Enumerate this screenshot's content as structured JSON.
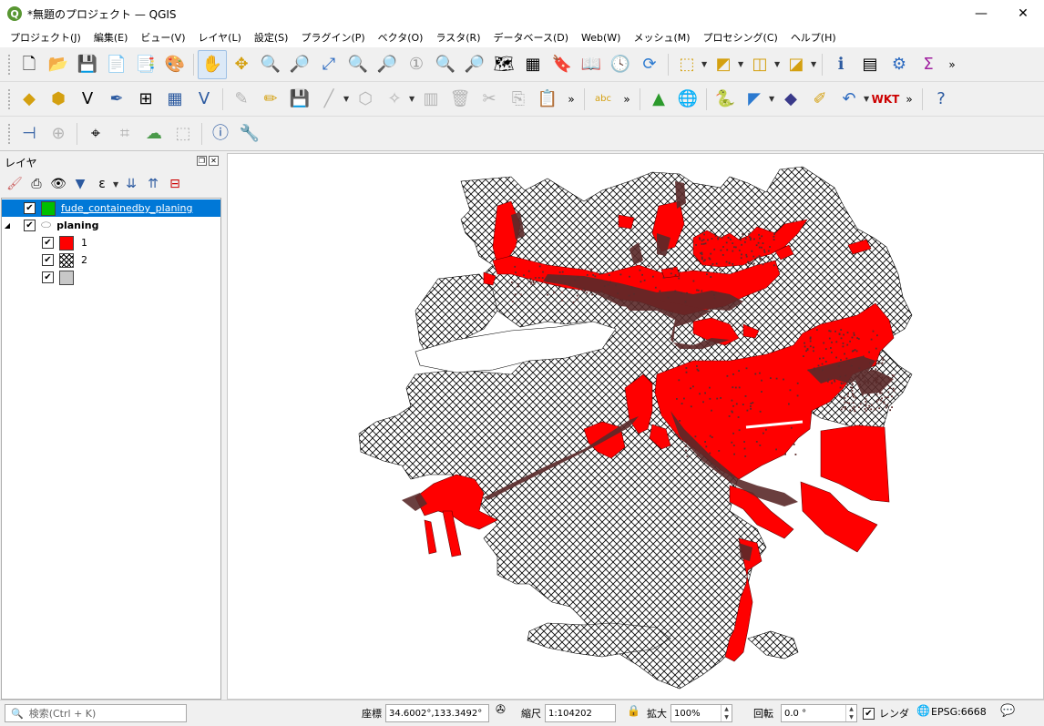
{
  "window": {
    "title": "*無題のプロジェクト — QGIS",
    "app_icon": "Q",
    "minimize": "—",
    "maximize": "☐",
    "close": "✕"
  },
  "menu": [
    "プロジェクト(J)",
    "編集(E)",
    "ビュー(V)",
    "レイヤ(L)",
    "設定(S)",
    "プラグイン(P)",
    "ベクタ(O)",
    "ラスタ(R)",
    "データベース(D)",
    "Web(W)",
    "メッシュ(M)",
    "プロセシング(C)",
    "ヘルプ(H)"
  ],
  "toolbar_more": "»",
  "layers_panel": {
    "title": "レイヤ",
    "layers": [
      {
        "name": "fude_containedby_planing",
        "checked": true,
        "color": "#00c000"
      },
      {
        "name": "planing",
        "checked": true,
        "expanded": true
      }
    ],
    "legend": [
      {
        "label": "1",
        "color": "#ff0000"
      },
      {
        "label": "2",
        "pattern": "crosshatch"
      },
      {
        "label": "",
        "color": "#c8c8c8"
      }
    ]
  },
  "map": {
    "background": "#ffffff",
    "fill_red": "#ff0000",
    "fill_dark": "#5a2a2a",
    "hatch_color": "#000000"
  },
  "status": {
    "search_placeholder": "検索(Ctrl + K)",
    "coord_label": "座標",
    "coord_value": "34.6002°,133.3492°",
    "scale_label": "縮尺",
    "scale_value": "1:104202",
    "magnify_label": "拡大",
    "magnify_value": "100%",
    "rotation_label": "回転",
    "rotation_value": "0.0 °",
    "render_label": "レンダ",
    "render_checked": true,
    "crs": "EPSG:6668"
  }
}
